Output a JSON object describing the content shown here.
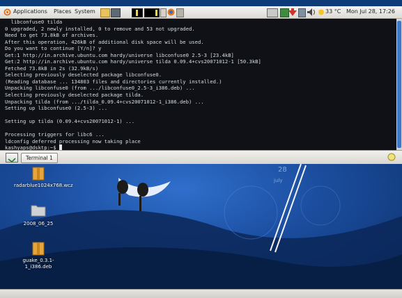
{
  "menu": {
    "applications": "Applications",
    "places": "Places",
    "system": "System"
  },
  "tray": {
    "temperature": "33 °C",
    "datetime": "Mon Jul 28, 17:26"
  },
  "terminal": {
    "lines": [
      "  libconfuse0 tilda",
      "0 upgraded, 2 newly installed, 0 to remove and 53 not upgraded.",
      "Need to get 73.8kB of archives.",
      "After this operation, 426kB of additional disk space will be used.",
      "Do you want to continue [Y/n]? y",
      "Get:1 http://in.archive.ubuntu.com hardy/universe libconfuse0 2.5-3 [23.4kB]",
      "Get:2 http://in.archive.ubuntu.com hardy/universe tilda 0.09.4+cvs20071012-1 [50.3kB]",
      "Fetched 73.8kB in 2s (32.9kB/s)",
      "Selecting previously deselected package libconfuse0.",
      "(Reading database ... 134803 files and directories currently installed.)",
      "Unpacking libconfuse0 (from .../libconfuse0_2.5-3_i386.deb) ...",
      "Selecting previously deselected package tilda.",
      "Unpacking tilda (from .../tilda_0.09.4+cvs20071012-1_i386.deb) ...",
      "Setting up libconfuse0 (2.5-3) ...",
      "",
      "Setting up tilda (0.09.4+cvs20071012-1) ...",
      "",
      "Processing triggers for libc6 ...",
      "ldconfig deferred processing now taking place",
      "kashyaps@dsktp:~$ "
    ]
  },
  "taskbar": {
    "window_label": "Terminal 1"
  },
  "desktop": {
    "icons": [
      {
        "label": "radarblue1024x768.wcz"
      },
      {
        "label": "2008_06_25"
      },
      {
        "label": "guake_0.3.1-1_i386.deb"
      }
    ],
    "calendar": {
      "day": "28",
      "month": "july"
    }
  }
}
